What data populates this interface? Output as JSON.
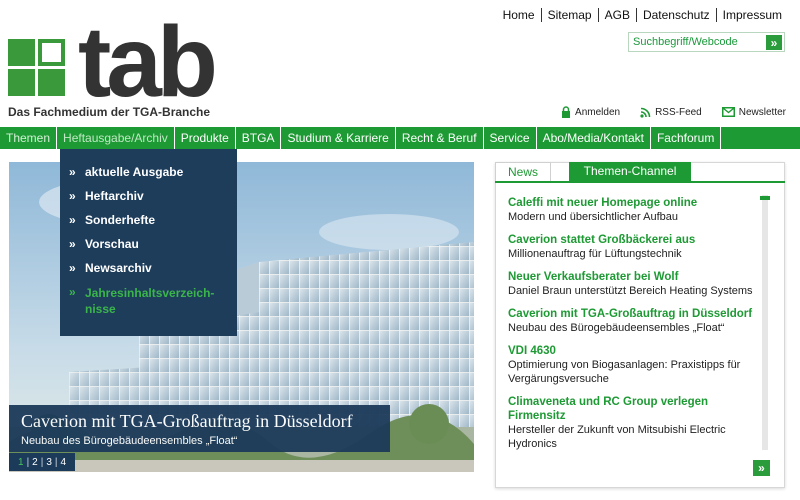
{
  "top_links": [
    "Home",
    "Sitemap",
    "AGB",
    "Datenschutz",
    "Impressum"
  ],
  "search": {
    "placeholder": "Suchbegriff/Webcode",
    "go_glyph": "»"
  },
  "logo": {
    "wordmark": "tab",
    "tagline": "Das Fachmedium der TGA-Branche"
  },
  "user_links": {
    "login": "Anmelden",
    "rss": "RSS-Feed",
    "newsletter": "Newsletter"
  },
  "nav": [
    "Themen",
    "Heftausgabe/Archiv",
    "Produkte",
    "BTGA",
    "Studium & Karriere",
    "Recht & Beruf",
    "Service",
    "Abo/Media/Kontakt",
    "Fachforum"
  ],
  "dropdown": {
    "bullet": "»",
    "items": [
      "aktuelle Ausgabe",
      "Heftarchiv",
      "Sonderhefte",
      "Vorschau",
      "Newsarchiv"
    ],
    "highlight_line1": "Jahresinhaltsverzeich-",
    "highlight_line2": "nisse"
  },
  "hero": {
    "title": "Caverion mit TGA-Großauftrag in Düsseldorf",
    "subtitle": "Neubau des Bürogebäudeensembles „Float“",
    "pages": [
      "1",
      "2",
      "3",
      "4"
    ]
  },
  "tabs": {
    "news": "News",
    "channel": "Themen-Channel"
  },
  "news": [
    {
      "title": "Caleffi mit neuer Homepage online",
      "desc": "Modern und übersichtlicher Aufbau"
    },
    {
      "title": "Caverion stattet Großbäckerei aus",
      "desc": "Millionenauftrag für Lüftungstechnik"
    },
    {
      "title": "Neuer Verkaufsberater bei Wolf",
      "desc": "Daniel Braun unterstützt Bereich Heating Systems"
    },
    {
      "title": "Caverion mit TGA-Großauftrag in Düsseldorf",
      "desc": "Neubau des Bürogebäudeensembles „Float“"
    },
    {
      "title": "VDI 4630",
      "desc": "Optimierung von Biogasanlagen: Praxistipps für Vergärungsversuche"
    },
    {
      "title": "Climaveneta und RC Group verlegen Firmensitz",
      "desc": "Hersteller der Zukunft von Mitsubishi Electric Hydronics"
    }
  ],
  "panel_next_glyph": "»",
  "colors": {
    "brand_green": "#1e9a34",
    "navy": "#1d3d5b"
  }
}
